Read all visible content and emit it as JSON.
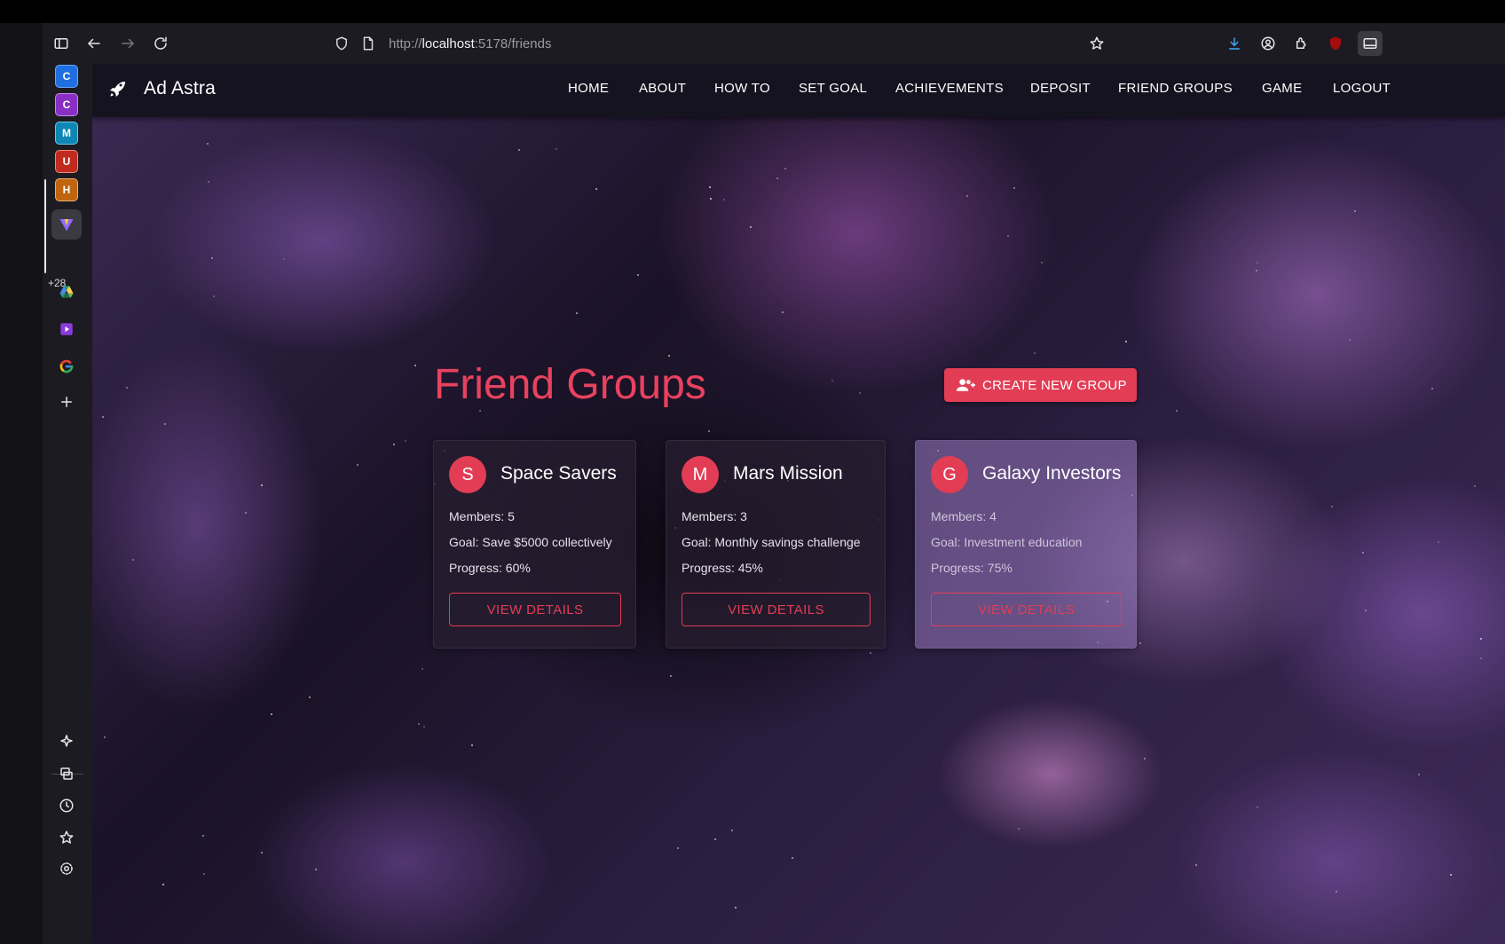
{
  "browser": {
    "url_scheme": "http://",
    "url_host": "localhost",
    "url_path": ":5178/friends",
    "sidebar_count": "+28",
    "sidebar_tabs": [
      {
        "letter": "C",
        "color": "#1f6fe0"
      },
      {
        "letter": "C",
        "color": "#8a2fc4"
      },
      {
        "letter": "M",
        "color": "#0e87b5"
      },
      {
        "letter": "U",
        "color": "#c02a1f"
      },
      {
        "letter": "H",
        "color": "#c0640f"
      }
    ]
  },
  "app": {
    "brand": "Ad Astra",
    "nav": [
      "HOME",
      "ABOUT",
      "HOW TO",
      "SET GOAL",
      "ACHIEVEMENTS",
      "DEPOSIT",
      "FRIEND GROUPS",
      "GAME",
      "LOGOUT"
    ]
  },
  "page": {
    "title": "Friend Groups",
    "create_button": "CREATE NEW GROUP",
    "groups": [
      {
        "initial": "S",
        "name": "Space Savers",
        "members": "Members: 5",
        "goal": "Goal: Save $5000 collectively",
        "progress": "Progress: 60%",
        "progress_value": 0.6,
        "button": "VIEW DETAILS"
      },
      {
        "initial": "M",
        "name": "Mars Mission",
        "members": "Members: 3",
        "goal": "Goal: Monthly savings challenge",
        "progress": "Progress: 45%",
        "progress_value": 0.45,
        "button": "VIEW DETAILS"
      },
      {
        "initial": "G",
        "name": "Galaxy Investors",
        "members": "Members: 4",
        "goal": "Goal: Investment education",
        "progress": "Progress: 75%",
        "progress_value": 0.75,
        "button": "VIEW DETAILS"
      }
    ]
  },
  "colors": {
    "accent": "#e23d55",
    "title": "#e8425e",
    "header_bg": "#14131f"
  }
}
